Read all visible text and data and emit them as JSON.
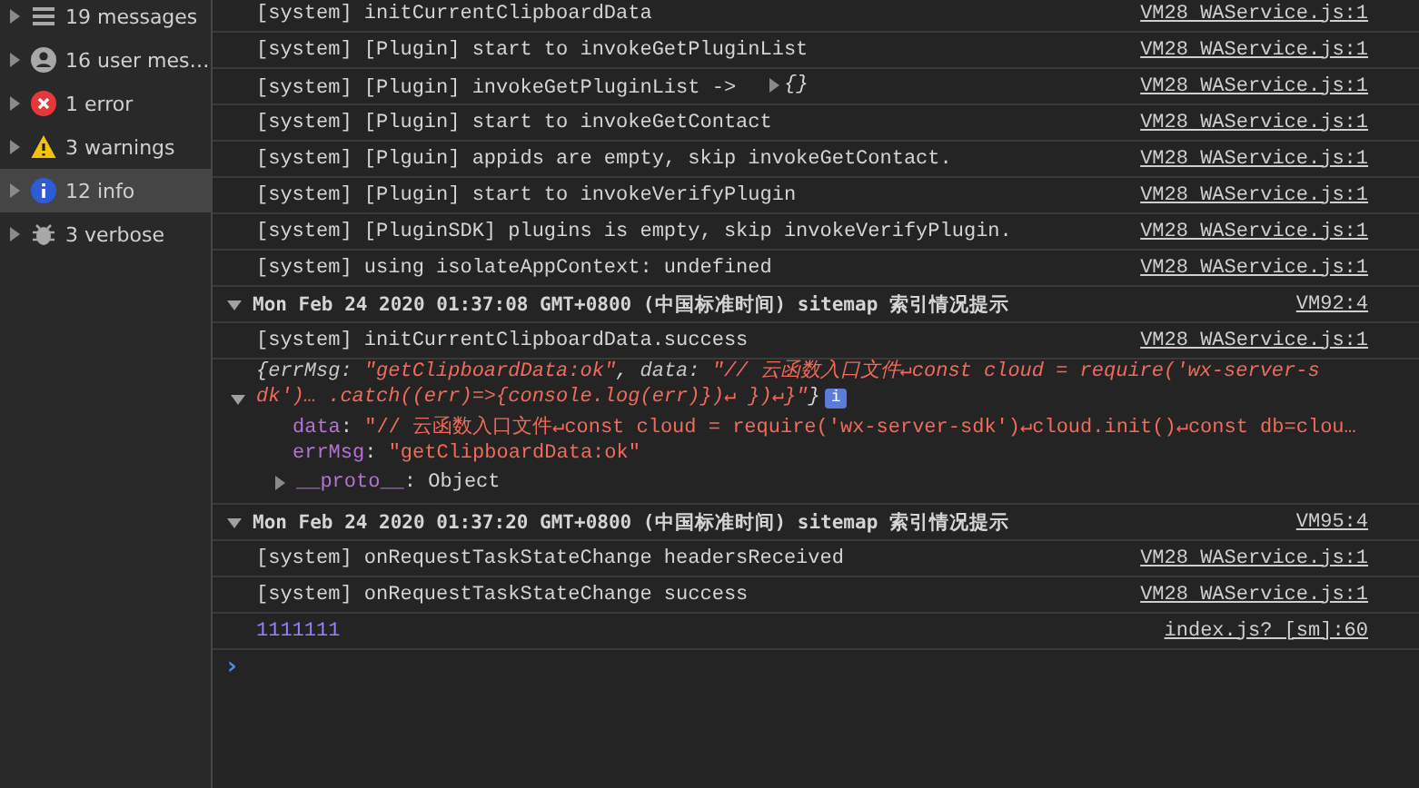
{
  "sidebar": {
    "items": [
      {
        "kind": "messages",
        "label": "19 messages",
        "selected": false
      },
      {
        "kind": "user",
        "label": "16 user mes…",
        "selected": false
      },
      {
        "kind": "error",
        "label": "1 error",
        "selected": false
      },
      {
        "kind": "warning",
        "label": "3 warnings",
        "selected": false
      },
      {
        "kind": "info",
        "label": "12 info",
        "selected": true
      },
      {
        "kind": "verbose",
        "label": "3 verbose",
        "selected": false
      }
    ]
  },
  "console": {
    "entries": [
      {
        "kind": "log",
        "text": "[system] initCurrentClipboardData",
        "source": "VM28 WAService.js:1"
      },
      {
        "kind": "log",
        "text": "[system] [Plugin] start to invokeGetPluginList",
        "source": "VM28 WAService.js:1"
      },
      {
        "kind": "log",
        "text": "[system] [Plugin] invokeGetPluginList ->",
        "object_preview": "{}",
        "source": "VM28 WAService.js:1"
      },
      {
        "kind": "log",
        "text": "[system] [Plugin] start to invokeGetContact",
        "source": "VM28 WAService.js:1"
      },
      {
        "kind": "log",
        "text": "[system] [Plguin] appids are empty, skip invokeGetContact.",
        "source": "VM28 WAService.js:1"
      },
      {
        "kind": "log",
        "text": "[system] [Plugin] start to invokeVerifyPlugin",
        "source": "VM28 WAService.js:1"
      },
      {
        "kind": "log",
        "text": "[system] [PluginSDK] plugins is empty, skip invokeVerifyPlugin.",
        "source": "VM28 WAService.js:1"
      },
      {
        "kind": "log",
        "text": "[system] using isolateAppContext: undefined",
        "source": "VM28 WAService.js:1"
      },
      {
        "kind": "group",
        "expanded": true,
        "text": "Mon Feb 24 2020 01:37:08 GMT+0800 (中国标准时间) sitemap 索引情况提示",
        "source": "VM92:4"
      },
      {
        "kind": "log",
        "text": "[system] initCurrentClipboardData.success",
        "source": "VM28 WAService.js:1"
      },
      {
        "kind": "object",
        "expanded": true,
        "preview": [
          {
            "kind": "punct",
            "text": "{"
          },
          {
            "kind": "key",
            "text": "errMsg: "
          },
          {
            "kind": "string",
            "text": "\"getClipboardData:ok\""
          },
          {
            "kind": "punct",
            "text": ", "
          },
          {
            "kind": "key",
            "text": "data: "
          },
          {
            "kind": "string",
            "text": "\"// 云函数入口文件↵const cloud = require('wx-server-sdk')…    .catch((err)=>{console.log(err)})↵     })↵}\""
          },
          {
            "kind": "punct",
            "text": "}"
          }
        ],
        "info_badge": "i",
        "properties": [
          {
            "kind": "string",
            "key": "data",
            "separator": ":",
            "value": "\"// 云函数入口文件↵const cloud = require('wx-server-sdk')↵cloud.init()↵const db=clou…"
          },
          {
            "kind": "string",
            "key": "errMsg",
            "separator": ":",
            "value": "\"getClipboardData:ok\""
          },
          {
            "kind": "proto",
            "key": "__proto__",
            "separator": ":",
            "value": "Object",
            "expanded": false
          }
        ]
      },
      {
        "kind": "group",
        "expanded": true,
        "text": "Mon Feb 24 2020 01:37:20 GMT+0800 (中国标准时间) sitemap 索引情况提示",
        "source": "VM95:4"
      },
      {
        "kind": "log",
        "text": "[system] onRequestTaskStateChange headersReceived",
        "source": "VM28 WAService.js:1"
      },
      {
        "kind": "log",
        "text": "[system] onRequestTaskStateChange success",
        "source": "VM28 WAService.js:1"
      },
      {
        "kind": "number",
        "text": "1111111",
        "source": "index.js? [sm]:60"
      }
    ],
    "prompt": "›"
  }
}
